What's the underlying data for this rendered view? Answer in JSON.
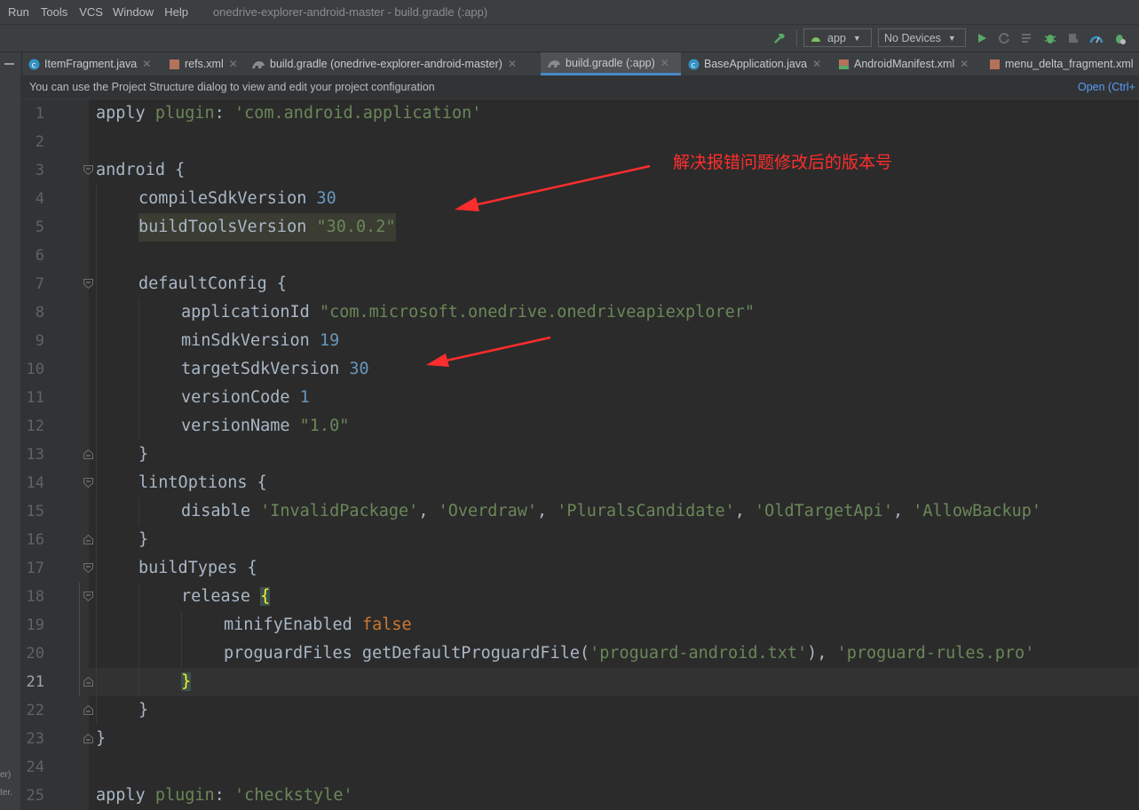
{
  "menu": {
    "run": "Run",
    "tools": "Tools",
    "vcs": "VCS",
    "window": "Window",
    "help": "Help",
    "window_title": "onedrive-explorer-android-master - build.gradle (:app)"
  },
  "toolbar": {
    "run_config": "app",
    "device": "No Devices"
  },
  "tabs": [
    {
      "label": "ItemFragment.java"
    },
    {
      "label": "refs.xml"
    },
    {
      "label": "build.gradle (onedrive-explorer-android-master)"
    },
    {
      "label": "build.gradle (:app)"
    },
    {
      "label": "BaseApplication.java"
    },
    {
      "label": "AndroidManifest.xml"
    },
    {
      "label": "menu_delta_fragment.xml"
    }
  ],
  "notice": {
    "message": "You can use the Project Structure dialog to view and edit your project configuration",
    "action": "Open (Ctrl+"
  },
  "left_strip": {
    "t1": "er)",
    "t2": "ter."
  },
  "annotation": "解决报错问题修改后的版本号",
  "code": {
    "l1": {
      "a": "apply ",
      "b": "plugin",
      "c": ": ",
      "d": "'com.android.application'"
    },
    "l3": {
      "a": "android {"
    },
    "l4": {
      "a": "compileSdkVersion ",
      "b": "30"
    },
    "l5": {
      "a": "buildToolsVersion ",
      "b": "\"30.0.2\""
    },
    "l7": {
      "a": "defaultConfig {"
    },
    "l8": {
      "a": "applicationId ",
      "b": "\"com.microsoft.onedrive.onedriveapiexplorer\""
    },
    "l9": {
      "a": "minSdkVersion ",
      "b": "19"
    },
    "l10": {
      "a": "targetSdkVersion ",
      "b": "30"
    },
    "l11": {
      "a": "versionCode ",
      "b": "1"
    },
    "l12": {
      "a": "versionName ",
      "b": "\"1.0\""
    },
    "l13": {
      "a": "}"
    },
    "l14": {
      "a": "lintOptions {"
    },
    "l15": {
      "a": "disable ",
      "b": "'InvalidPackage'",
      "c": ", ",
      "d": "'Overdraw'",
      "e": ", ",
      "f": "'PluralsCandidate'",
      "g": ", ",
      "h": "'OldTargetApi'",
      "i": ", ",
      "j": "'AllowBackup'"
    },
    "l16": {
      "a": "}"
    },
    "l17": {
      "a": "buildTypes {"
    },
    "l18": {
      "a": "release ",
      "b": "{"
    },
    "l19": {
      "a": "minifyEnabled ",
      "b": "false"
    },
    "l20": {
      "a": "proguardFiles getDefaultProguardFile(",
      "b": "'proguard-android.txt'",
      "c": "), ",
      "d": "'proguard-rules.pro'"
    },
    "l21": {
      "a": "}"
    },
    "l22": {
      "a": "}"
    },
    "l23": {
      "a": "}"
    },
    "l25": {
      "a": "apply ",
      "b": "plugin",
      "c": ": ",
      "d": "'checkstyle'"
    }
  },
  "line_numbers": [
    "1",
    "2",
    "3",
    "4",
    "5",
    "6",
    "7",
    "8",
    "9",
    "10",
    "11",
    "12",
    "13",
    "14",
    "15",
    "16",
    "17",
    "18",
    "19",
    "20",
    "21",
    "22",
    "23",
    "24",
    "25"
  ],
  "colors": {
    "keyword": "#cc7832",
    "string": "#6a8759",
    "number": "#6897bb",
    "identifier": "#a9b7c6",
    "annotation": "#ff2d2d",
    "link": "#589df6"
  }
}
